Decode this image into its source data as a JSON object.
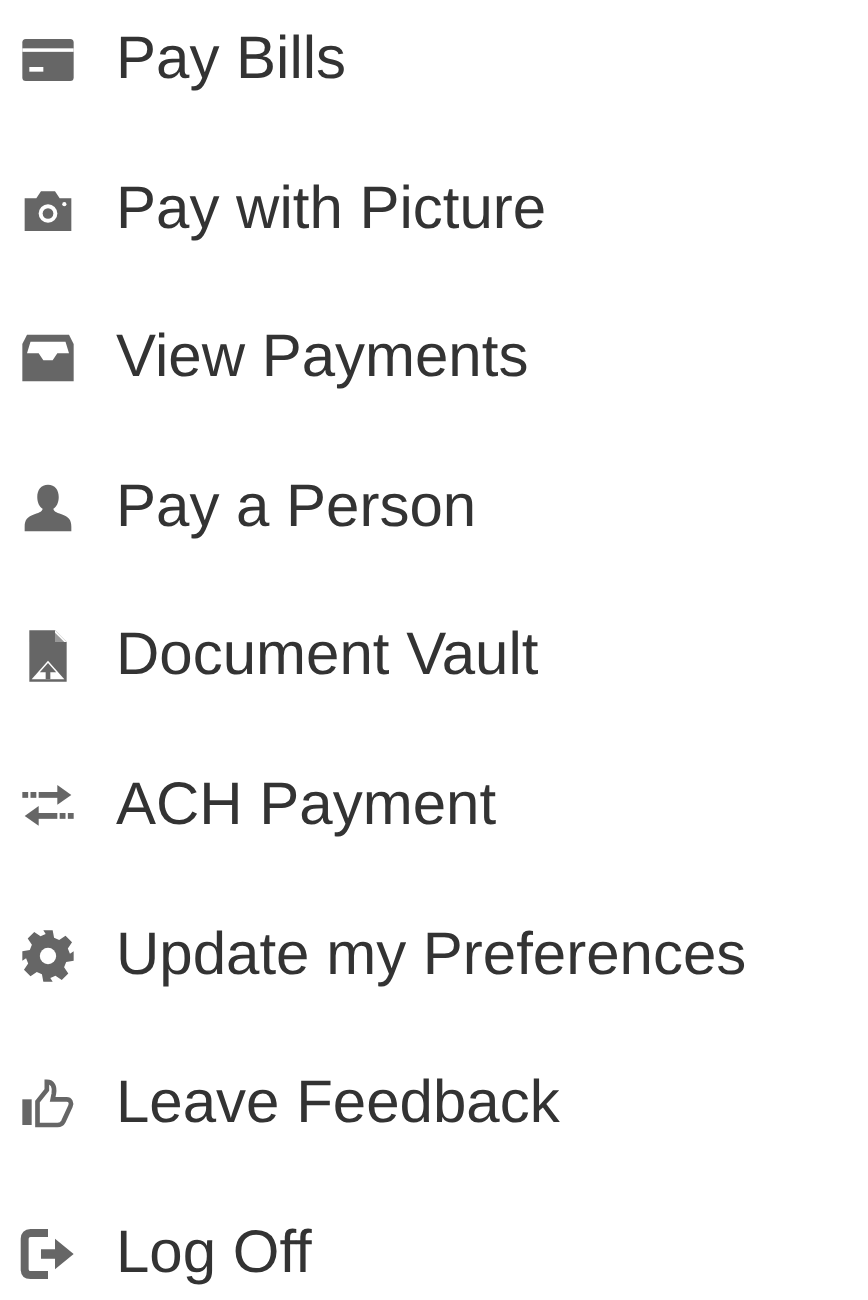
{
  "menu": {
    "items": [
      {
        "label": "Pay Bills"
      },
      {
        "label": "Pay with Picture"
      },
      {
        "label": "View Payments"
      },
      {
        "label": "Pay a Person"
      },
      {
        "label": "Document Vault"
      },
      {
        "label": "ACH Payment"
      },
      {
        "label": "Update my Preferences"
      },
      {
        "label": "Leave Feedback"
      },
      {
        "label": "Log Off"
      }
    ]
  }
}
